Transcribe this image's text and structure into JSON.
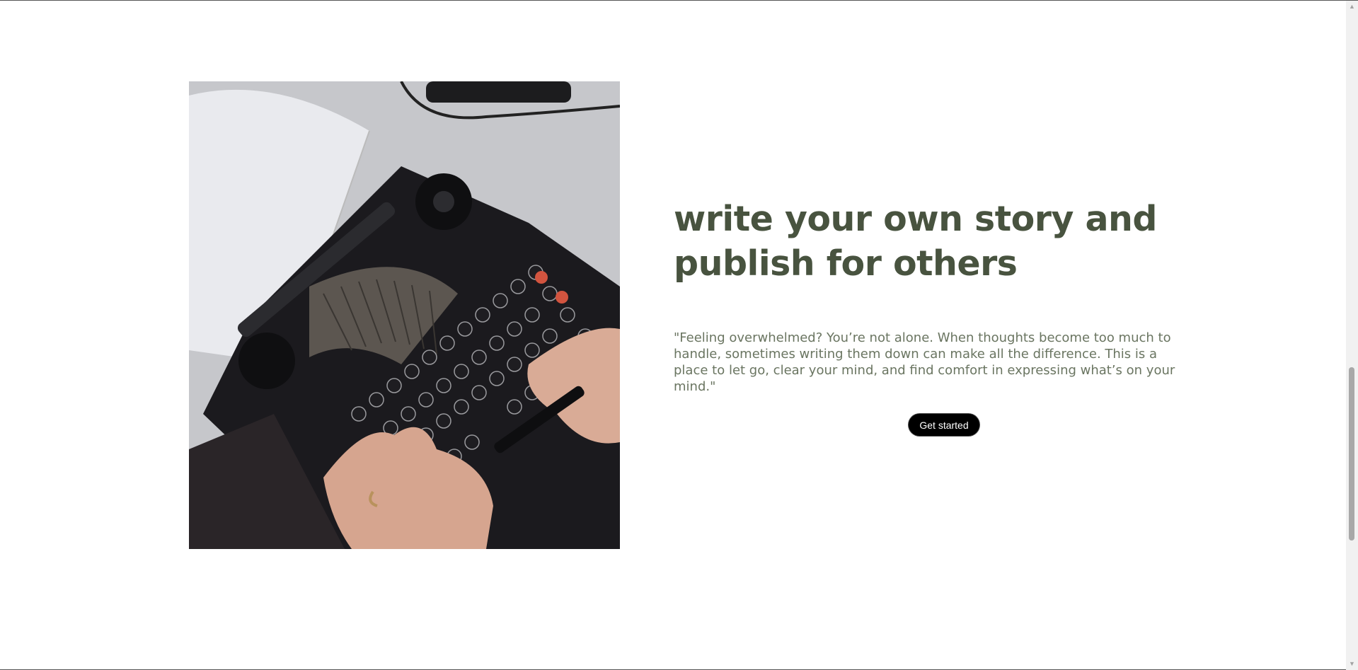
{
  "hero": {
    "title": "write your own story and publish for others",
    "quote": "\"Feeling overwhelmed? You’re not alone. When thoughts become too much to handle, sometimes writing them down can make all the difference. This is a place to let go, clear your mind, and find comfort in expressing what’s on your mind.\"",
    "cta_label": "Get started",
    "image_icon": "typewriter-photo"
  },
  "colors": {
    "title": "#48533f",
    "quote": "#6a7561",
    "button_bg": "#000000",
    "button_text": "#ffffff"
  },
  "scrollbar": {
    "up_icon": "scroll-up-arrow-icon",
    "down_icon": "scroll-down-arrow-icon"
  }
}
